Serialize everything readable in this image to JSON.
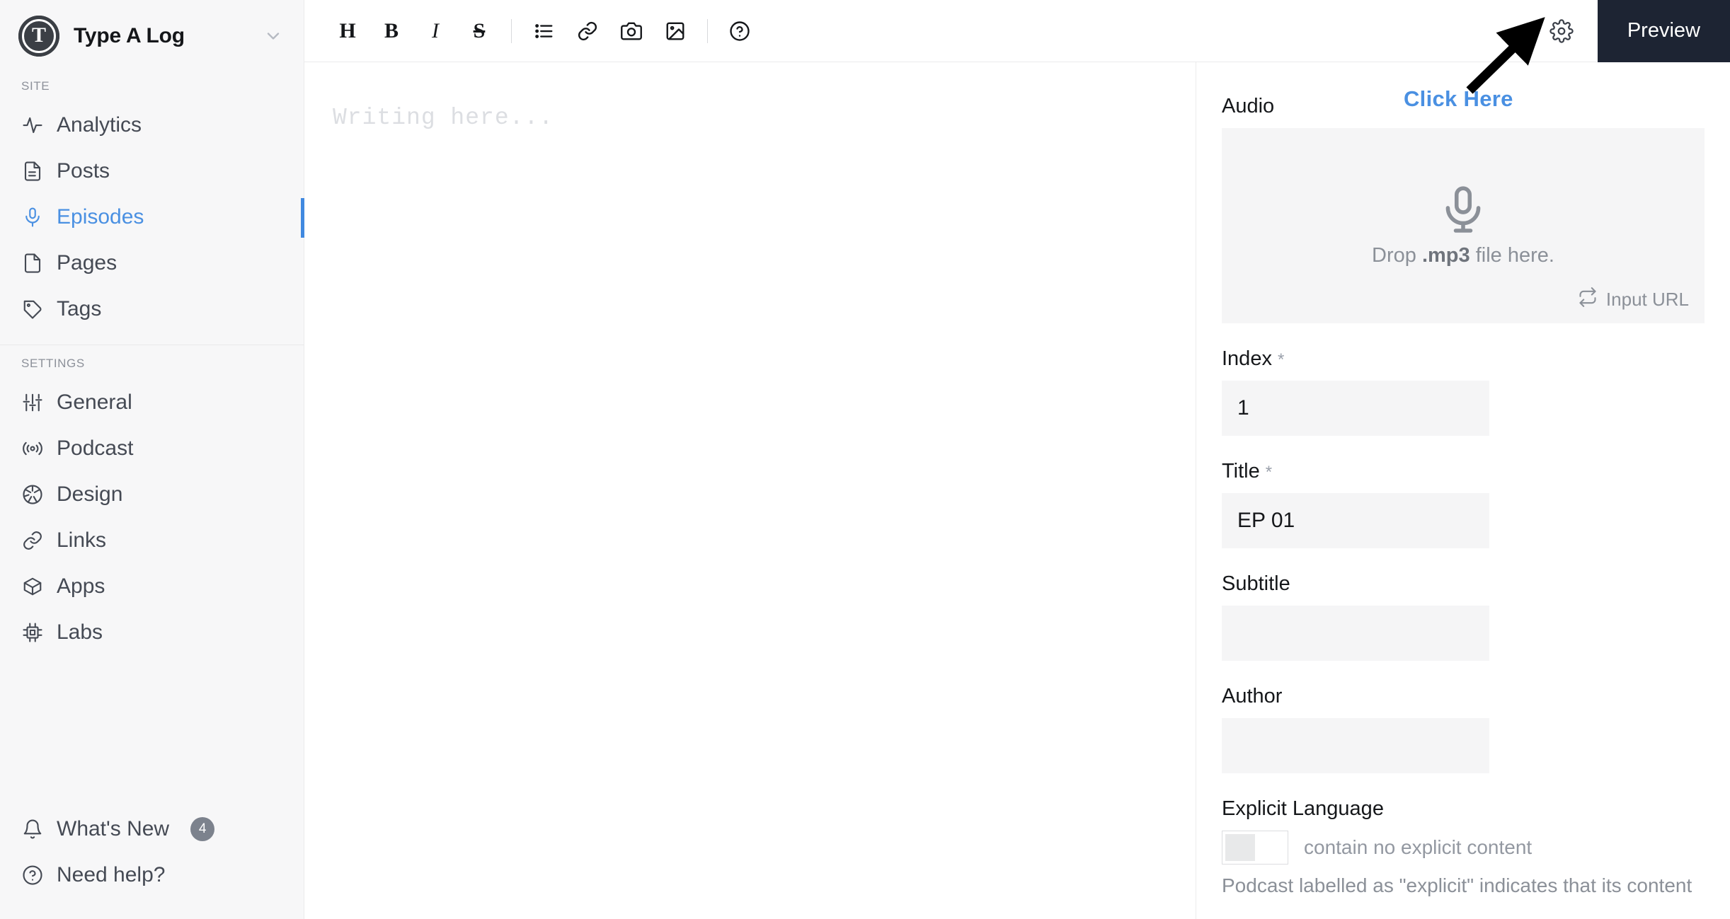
{
  "brand": {
    "logo_letter": "T",
    "name": "Type A Log",
    "caret_icon": "chevron-down-icon"
  },
  "sidebar": {
    "sections": [
      {
        "heading": "SITE",
        "items": [
          {
            "label": "Analytics",
            "icon": "activity-icon",
            "active": false
          },
          {
            "label": "Posts",
            "icon": "document-text-icon",
            "active": false
          },
          {
            "label": "Episodes",
            "icon": "microphone-icon",
            "active": true
          },
          {
            "label": "Pages",
            "icon": "file-icon",
            "active": false
          },
          {
            "label": "Tags",
            "icon": "tag-icon",
            "active": false
          }
        ]
      },
      {
        "heading": "SETTINGS",
        "items": [
          {
            "label": "General",
            "icon": "sliders-icon",
            "active": false
          },
          {
            "label": "Podcast",
            "icon": "broadcast-icon",
            "active": false
          },
          {
            "label": "Design",
            "icon": "aperture-icon",
            "active": false
          },
          {
            "label": "Links",
            "icon": "link-icon",
            "active": false
          },
          {
            "label": "Apps",
            "icon": "package-icon",
            "active": false
          },
          {
            "label": "Labs",
            "icon": "chip-icon",
            "active": false
          }
        ]
      }
    ],
    "bottom_items": [
      {
        "label": "What's New",
        "icon": "bell-icon",
        "badge": "4"
      },
      {
        "label": "Need help?",
        "icon": "question-circle-icon",
        "badge": ""
      }
    ],
    "active_accent_color": "#4089e0"
  },
  "toolbar": {
    "buttons": [
      {
        "label": "H",
        "name": "heading-button",
        "type": "text"
      },
      {
        "label": "B",
        "name": "bold-button",
        "type": "text"
      },
      {
        "label": "I",
        "name": "italic-button",
        "type": "text"
      },
      {
        "label": "S",
        "name": "strikethrough-button",
        "type": "text"
      },
      {
        "label": "",
        "name": "bullet-list-button",
        "type": "icon"
      },
      {
        "label": "",
        "name": "link-button",
        "type": "icon"
      },
      {
        "label": "",
        "name": "camera-button",
        "type": "icon"
      },
      {
        "label": "",
        "name": "image-button",
        "type": "icon"
      },
      {
        "label": "",
        "name": "help-button",
        "type": "icon"
      }
    ],
    "settings_icon": "gear-icon",
    "preview_label": "Preview"
  },
  "editor": {
    "placeholder": "Writing here..."
  },
  "panel": {
    "audio": {
      "label": "Audio",
      "drop_prefix": "Drop ",
      "drop_strong": ".mp3",
      "drop_suffix": " file here.",
      "input_url_label": "Input URL",
      "mic_icon": "microphone-icon",
      "swap_icon": "swap-icon"
    },
    "index": {
      "label": "Index",
      "required": "*",
      "value": "1"
    },
    "title": {
      "label": "Title",
      "required": "*",
      "value": "EP 01"
    },
    "subtitle": {
      "label": "Subtitle",
      "value": ""
    },
    "author": {
      "label": "Author",
      "value": ""
    },
    "explicit": {
      "label": "Explicit Language",
      "checkbox_label": "contain no explicit content",
      "hint": "Podcast labelled as \"explicit\" indicates that its content"
    }
  },
  "annotation": {
    "click_here_label": "Click Here",
    "color": "#4a90e2",
    "arrow_icon": "arrow-pointer-icon"
  }
}
